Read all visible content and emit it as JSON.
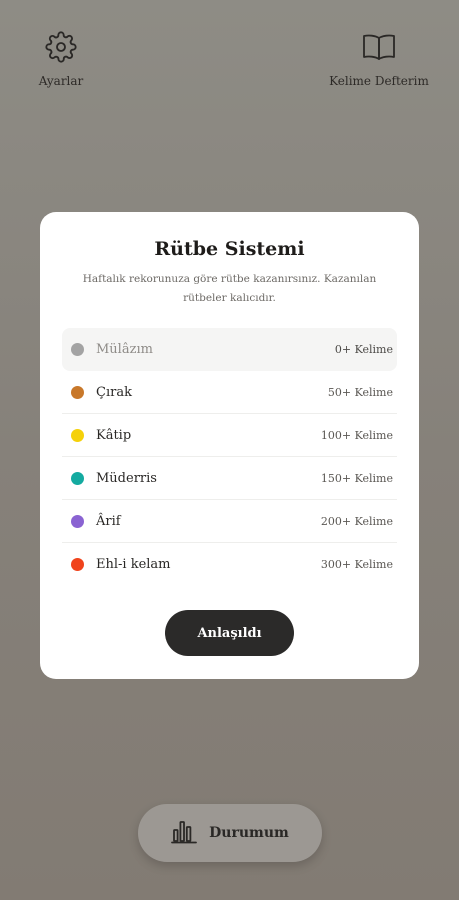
{
  "header": {
    "settings_label": "Ayarlar",
    "notebook_label": "Kelime Defterim"
  },
  "modal": {
    "title": "Rütbe Sistemi",
    "subtitle": "Haftalık rekorunuza göre rütbe kazanırsınız. Kazanılan rütbeler kalıcıdır.",
    "ranks": [
      {
        "name": "Mülâzım",
        "requirement": "0+ Kelime",
        "color": "#a3a3a3",
        "active": true
      },
      {
        "name": "Çırak",
        "requirement": "50+ Kelime",
        "color": "#c8782a",
        "active": false
      },
      {
        "name": "Kâtip",
        "requirement": "100+ Kelime",
        "color": "#f5d10a",
        "active": false
      },
      {
        "name": "Müderris",
        "requirement": "150+ Kelime",
        "color": "#14aaa0",
        "active": false
      },
      {
        "name": "Ârif",
        "requirement": "200+ Kelime",
        "color": "#8a63d2",
        "active": false
      },
      {
        "name": "Ehl-i kelam",
        "requirement": "300+ Kelime",
        "color": "#f0431c",
        "active": false
      }
    ],
    "ok_label": "Anlaşıldı"
  },
  "bottom": {
    "status_label": "Durumum"
  },
  "icons": {
    "settings": "gear-icon",
    "notebook": "open-book-icon",
    "status": "bar-chart-icon"
  }
}
